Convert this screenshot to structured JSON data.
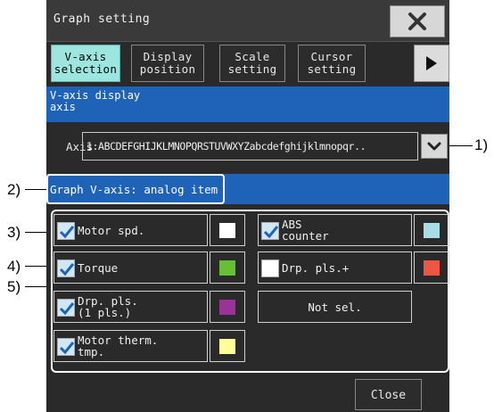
{
  "window": {
    "title": "Graph setting",
    "close_icon": "close-x-icon"
  },
  "tabs": [
    {
      "label": "V-axis selection",
      "active": true
    },
    {
      "label": "Display position",
      "active": false
    },
    {
      "label": "Scale setting",
      "active": false
    },
    {
      "label": "Cursor setting",
      "active": false
    }
  ],
  "next_tab_icon": "play-right-icon",
  "section_header": "V-axis display axis",
  "axis": {
    "label": "Axis",
    "value": "1:ABCDEFGHIJKLMNOPQRSTUVWXYZabcdefghijklmnopqr..",
    "dropdown_icon": "chevron-down-icon"
  },
  "subheader": "Graph V-axis: analog item",
  "items": [
    {
      "label": "Motor spd.",
      "checked": true,
      "color": "#ffffff"
    },
    {
      "label": "Torque",
      "checked": true,
      "color": "#66c033"
    },
    {
      "label": "Drp. pls. (1 pls.)",
      "checked": true,
      "color": "#993399"
    },
    {
      "label": "Motor therm. tmp.",
      "checked": true,
      "color": "#ffff99"
    },
    {
      "label": "ABS counter",
      "checked": true,
      "color": "#a8dde6"
    },
    {
      "label": "Drp. pls.+",
      "checked": false,
      "color": "#ee5544"
    },
    {
      "label": "Not sel.",
      "checked": null,
      "color": null
    }
  ],
  "footer": {
    "close_label": "Close"
  },
  "callouts": [
    "1)",
    "2)",
    "3)",
    "4)",
    "5)"
  ]
}
